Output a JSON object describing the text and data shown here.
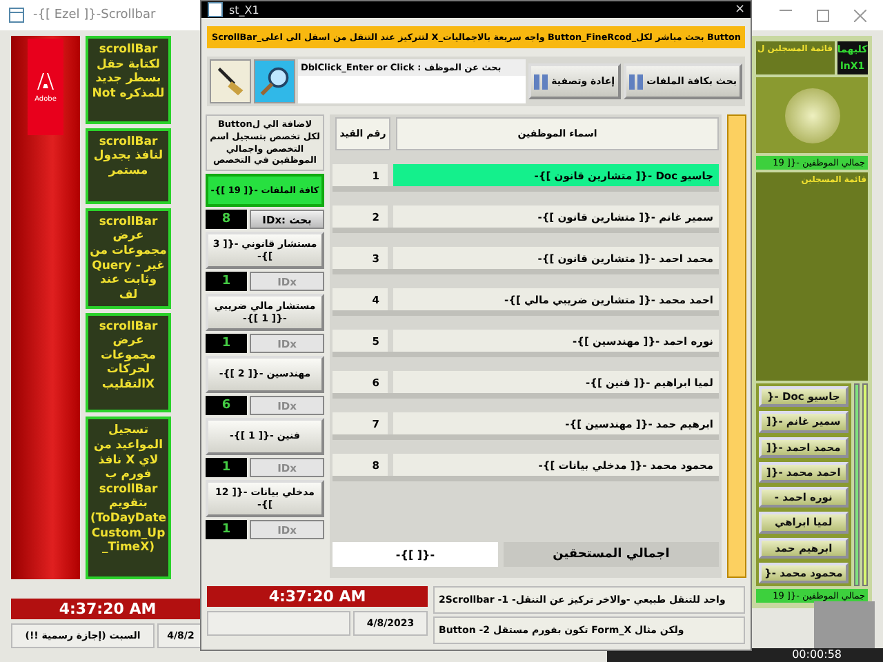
{
  "back_window": {
    "title": "-{[ Ezel ]}-Scrollbar",
    "logo": "Adobe",
    "cards": [
      {
        "text": "scrollBar لكتابة حقل بسطر جديد Not للمذكره"
      },
      {
        "text": "scrollBar لنافذ بجدول مستمر"
      },
      {
        "text": "scrollBar عرض مجموعات من Query - غير وثابت عند لف"
      },
      {
        "text": "scrollBar عرض مجموعات لحركات التقليبX"
      },
      {
        "text": "تسجيل المواعيد من نافذ X لاي فورم ب scrollBar بتقويم (ToDayDate Custom_Up _TimeX)"
      }
    ],
    "time": "4:37:20 AM",
    "day": "السبت (إجازة رسمية !!)",
    "date": "4/8/2"
  },
  "right_panel": {
    "title": "قائمة المسجلين ل",
    "badge_top": "كليهما",
    "badge_bottom": "lnX1",
    "total": "جمالي الموظفين -{[ 19",
    "list_title": "قائمة المسجلين",
    "buttons": [
      "جاسيو Doc -{",
      "سمير غانم -{[",
      "محمد احمد -{[",
      "احمد محمد -{[",
      "نوره احمد -",
      "لميا ابراهي",
      "ابرهيم حمد",
      "محمود محمد -{"
    ],
    "footer": "جمالي الموظفين -{[ 19"
  },
  "dialog": {
    "title": "st_X1",
    "close": "×",
    "banner": "Button بحث مباشر لكل_Button_FineRcod واجه سريعة بالاجماليات_X لتتركيز عند التنقل من اسفل الى اعلى_ScrollBar",
    "search_label": "DblClick_Enter or Click : بحث عن الموظف",
    "buttons": [
      "بحث بكافة الملفات",
      "إعادة وتصفية"
    ],
    "hint": "لاضافة الي لButton لكل تخصص بتسجيل اسم التخصص واجمالي الموظفين في التخصص",
    "all_files": "كافة الملفات -{[ 19 ]}-",
    "search_id": {
      "value": "8",
      "label": "بحث :IDx",
      "disabled": false
    },
    "categories": [
      {
        "label": "مستشار قانوني -{[ 3 ]}-",
        "count": "1",
        "id_label": "IDx",
        "disabled": true
      },
      {
        "label": "مستشار مالي ضريبي -{[ 1 ]}-",
        "count": "1",
        "id_label": "IDx",
        "disabled": true
      },
      {
        "label": "مهندسين -{[ 2 ]}-",
        "count": "6",
        "id_label": "IDx",
        "disabled": true
      },
      {
        "label": "فنين -{[ 1 ]}-",
        "count": "1",
        "id_label": "IDx",
        "disabled": true
      },
      {
        "label": "مدخلي بيانات -{[ 12 ]}-",
        "count": "1",
        "id_label": "IDx",
        "disabled": true
      }
    ],
    "columns": [
      "اسماء الموظفين",
      "رقم القيد"
    ],
    "rows": [
      {
        "number": "1",
        "name": "جاسيو Doc -{[ متشارين قانون ]}-",
        "selected": true
      },
      {
        "number": "2",
        "name": "سمير غانم -{[ متشارين قانون ]}-",
        "selected": false
      },
      {
        "number": "3",
        "name": "محمد احمد -{[ متشارين قانون ]}-",
        "selected": false
      },
      {
        "number": "4",
        "name": "احمد محمد -{[ متشارين ضريبي مالي ]}-",
        "selected": false
      },
      {
        "number": "5",
        "name": "نوره احمد -{[ مهندسين ]}-",
        "selected": false
      },
      {
        "number": "6",
        "name": "لميا ابراهيم -{[ فنين ]}-",
        "selected": false
      },
      {
        "number": "7",
        "name": "ابرهيم حمد -{[ مهندسين ]}-",
        "selected": false
      },
      {
        "number": "8",
        "name": "محمود محمد -{[ مدخلي بيانات ]}-",
        "selected": false
      }
    ],
    "total_label": "اجمالي المستحقين",
    "total_value": "-{[ ]}-",
    "time": "4:37:20 AM",
    "date": "4/8/2023",
    "notes": [
      "واحد للتنقل طبيعي -والاخر تركيز عن التنقل- 1- 2Scrollbar",
      "ولكن مثال Form_X تكون بفورم مستقل Button -2"
    ]
  },
  "recorder": {
    "timer": "00:00:58"
  }
}
